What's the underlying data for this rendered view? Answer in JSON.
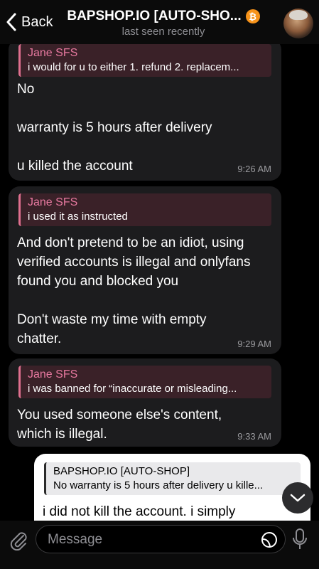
{
  "header": {
    "back_label": "Back",
    "title": "BAPSHOP.IO [AUTO-SHO...",
    "subtitle": "last seen recently",
    "badge_symbol": "₿"
  },
  "messages": [
    {
      "reply_name": "Jane SFS",
      "reply_text": "i would for u to either 1. refund 2. replacem...",
      "lines": [
        "No",
        "",
        "warranty is 5 hours after delivery",
        "",
        "u killed the account"
      ],
      "time": "9:26 AM"
    },
    {
      "reply_name": "Jane SFS",
      "reply_text": "i used it as instructed",
      "lines": [
        "And don't pretend to be an idiot, using",
        "verified accounts is illegal and onlyfans",
        "found you and blocked you",
        "",
        "Don't waste my time with empty",
        "chatter."
      ],
      "time": "9:29 AM"
    },
    {
      "reply_name": "Jane SFS",
      "reply_text": "i was banned for “inaccurate or misleading...",
      "lines": [
        "You used someone else's content,",
        "which is illegal."
      ],
      "time": "9:33 AM"
    },
    {
      "reply_name": "BAPSHOP.IO [AUTO-SHOP]",
      "reply_text": "No warranty is 5 hours after delivery u kille...",
      "lines": [
        "i did not kill the account. i simply"
      ]
    }
  ],
  "input": {
    "placeholder": "Message"
  },
  "icons": {
    "back": "chevron-left-icon",
    "badge": "bitcoin-icon",
    "scroll": "chevron-down-icon",
    "attach": "paperclip-icon",
    "sticker": "sticker-icon",
    "mic": "microphone-icon"
  },
  "colors": {
    "reply_accent": "#e0708f",
    "reply_name": "#e879a0",
    "incoming_bubble": "#1c1c1e",
    "outgoing_bubble": "#ffffff",
    "badge": "#f7931a"
  }
}
